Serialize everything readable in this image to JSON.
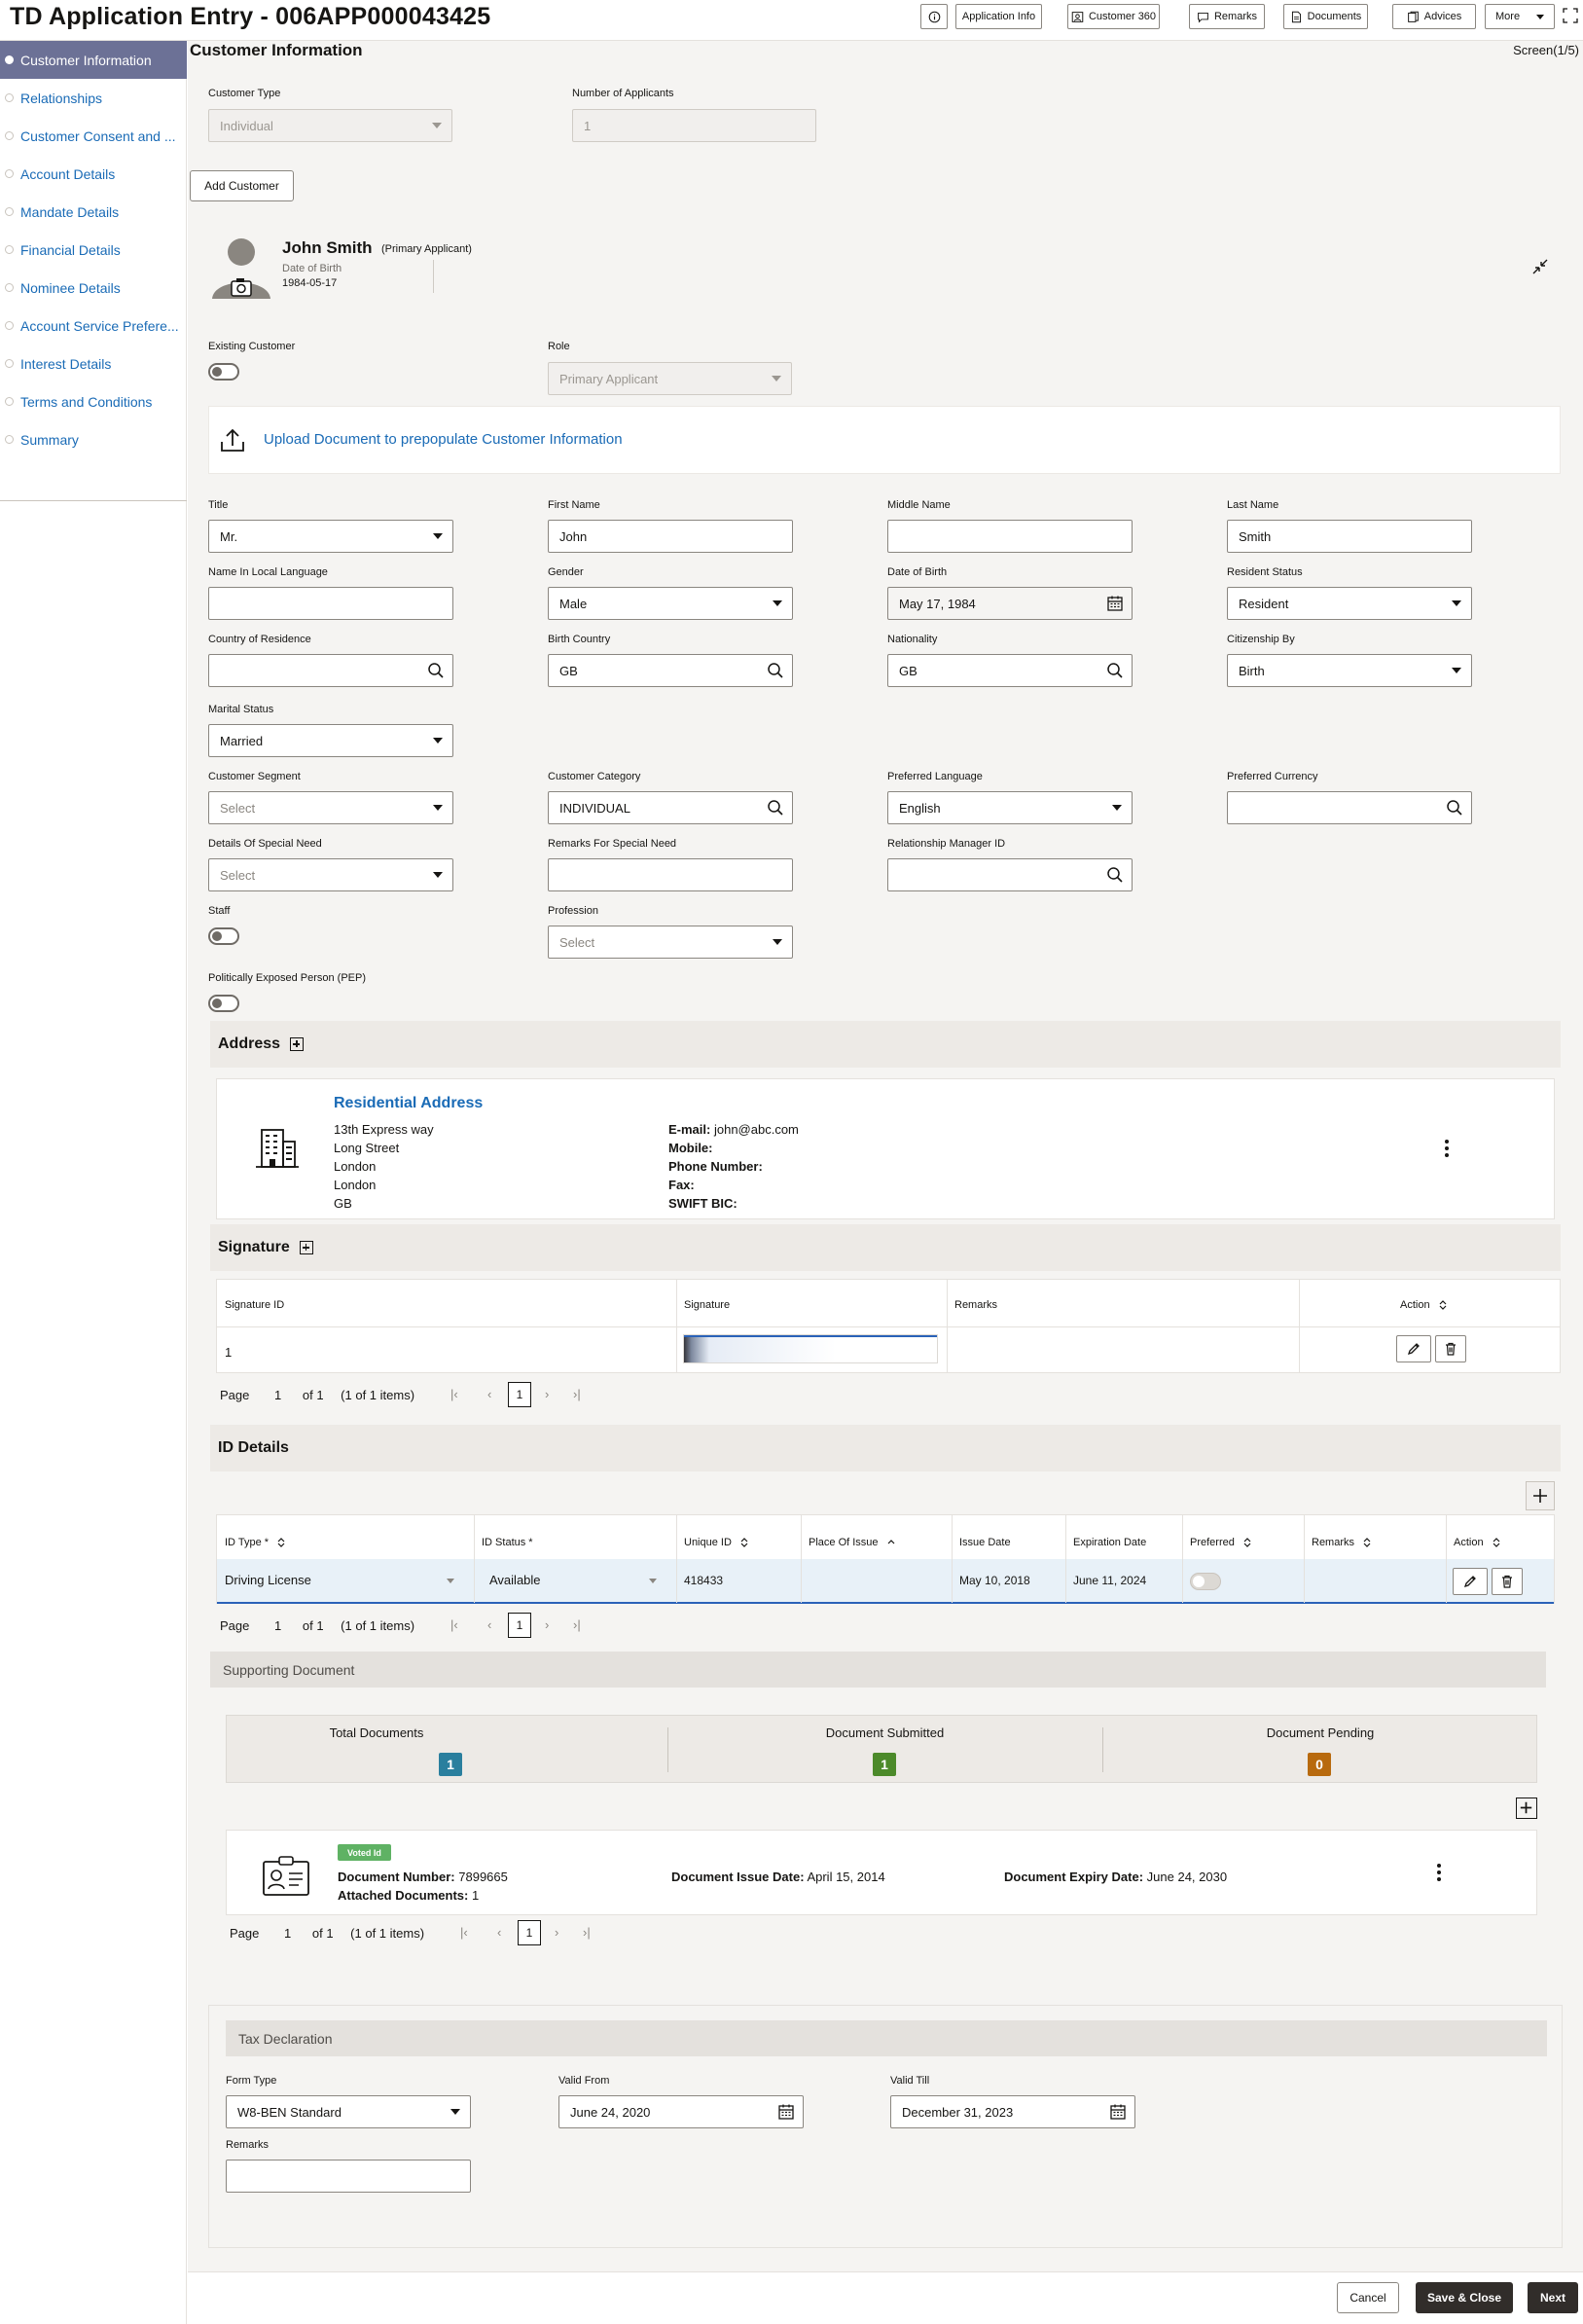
{
  "app": {
    "title": "TD Application Entry - 006APP000043425"
  },
  "toolbar": {
    "info_icon": "info-icon",
    "buttons": [
      {
        "label": "Application Info"
      },
      {
        "label": "Customer 360"
      },
      {
        "label": "Remarks"
      },
      {
        "label": "Documents"
      },
      {
        "label": "Advices"
      },
      {
        "label": "More"
      }
    ]
  },
  "sidebar": {
    "items": [
      {
        "label": "Customer Information",
        "active": true
      },
      {
        "label": "Relationships"
      },
      {
        "label": "Customer Consent and ..."
      },
      {
        "label": "Account Details"
      },
      {
        "label": "Mandate Details"
      },
      {
        "label": "Financial Details"
      },
      {
        "label": "Nominee Details"
      },
      {
        "label": "Account Service Prefere..."
      },
      {
        "label": "Interest Details"
      },
      {
        "label": "Terms and Conditions"
      },
      {
        "label": "Summary"
      }
    ]
  },
  "page": {
    "title": "Customer Information",
    "screen": "Screen(1/5)"
  },
  "customer_top": {
    "customer_type_label": "Customer Type",
    "customer_type_value": "Individual",
    "num_applicants_label": "Number of Applicants",
    "num_applicants_value": "1",
    "add_customer": "Add Customer"
  },
  "applicant": {
    "name": "John Smith",
    "tag": "(Primary Applicant)",
    "dob_label": "Date of Birth",
    "dob_value": "1984-05-17",
    "existing_customer_label": "Existing Customer",
    "role_label": "Role",
    "role_value": "Primary Applicant",
    "upload_label": "Upload Document to prepopulate Customer Information"
  },
  "form": {
    "title": {
      "label": "Title",
      "value": "Mr."
    },
    "first_name": {
      "label": "First Name",
      "value": "John"
    },
    "middle_name": {
      "label": "Middle Name",
      "value": ""
    },
    "last_name": {
      "label": "Last Name",
      "value": "Smith"
    },
    "local_name": {
      "label": "Name In Local Language",
      "value": ""
    },
    "gender": {
      "label": "Gender",
      "value": "Male"
    },
    "dob": {
      "label": "Date of Birth",
      "value": "May 17, 1984"
    },
    "resident_status": {
      "label": "Resident Status",
      "value": "Resident"
    },
    "country_residence": {
      "label": "Country of Residence",
      "value": ""
    },
    "birth_country": {
      "label": "Birth Country",
      "value": "GB"
    },
    "nationality": {
      "label": "Nationality",
      "value": "GB"
    },
    "citizenship_by": {
      "label": "Citizenship By",
      "value": "Birth"
    },
    "marital_status": {
      "label": "Marital Status",
      "value": "Married"
    },
    "customer_segment": {
      "label": "Customer Segment",
      "value": "Select"
    },
    "customer_category": {
      "label": "Customer Category",
      "value": "INDIVIDUAL"
    },
    "preferred_language": {
      "label": "Preferred Language",
      "value": "English"
    },
    "preferred_currency": {
      "label": "Preferred Currency",
      "value": ""
    },
    "special_need": {
      "label": "Details Of Special Need",
      "value": "Select"
    },
    "special_need_remarks": {
      "label": "Remarks For Special Need",
      "value": ""
    },
    "rm_id": {
      "label": "Relationship Manager ID",
      "value": ""
    },
    "staff": {
      "label": "Staff"
    },
    "profession": {
      "label": "Profession",
      "value": "Select"
    },
    "pep": {
      "label": "Politically Exposed Person (PEP)"
    }
  },
  "address": {
    "section_title": "Address",
    "card_title": "Residential Address",
    "lines": [
      "13th Express way",
      "Long Street",
      "London",
      "London",
      "GB"
    ],
    "email_label": "E-mail:",
    "email_value": "john@abc.com",
    "mobile_label": "Mobile:",
    "phone_label": "Phone Number:",
    "fax_label": "Fax:",
    "swift_label": "SWIFT BIC:"
  },
  "signature": {
    "section_title": "Signature",
    "columns": [
      "Signature ID",
      "Signature",
      "Remarks",
      "Action"
    ],
    "rows": [
      {
        "id": "1",
        "remarks": ""
      }
    ],
    "pager": {
      "page_label": "Page",
      "page": "1",
      "of": "of 1",
      "items": "(1 of 1 items)",
      "current": "1"
    }
  },
  "id_details": {
    "section_title": "ID Details",
    "columns": [
      "ID Type *",
      "ID Status *",
      "Unique ID",
      "Place Of Issue",
      "Issue Date",
      "Expiration Date",
      "Preferred",
      "Remarks",
      "Action"
    ],
    "rows": [
      {
        "id_type": "Driving License",
        "id_status": "Available",
        "unique_id": "418433",
        "place": "",
        "issue_date": "May 10, 2018",
        "expiry_date": "June 11, 2024",
        "remarks": ""
      }
    ],
    "pager": {
      "page_label": "Page",
      "page": "1",
      "of": "of 1",
      "items": "(1 of 1 items)",
      "current": "1"
    }
  },
  "supporting_docs": {
    "section_title": "Supporting Document",
    "total_label": "Total Documents",
    "total": "1",
    "submitted_label": "Document Submitted",
    "submitted": "1",
    "pending_label": "Document Pending",
    "pending": "0",
    "colors": {
      "total": "#2a7f9e",
      "submitted": "#4c8a2a",
      "pending": "#b86a0e",
      "tag": "#5fb264"
    },
    "doc": {
      "tag": "Voted Id",
      "number_label": "Document Number:",
      "number": "7899665",
      "attached_label": "Attached Documents:",
      "attached": "1",
      "issue_label": "Document Issue Date:",
      "issue": "April 15, 2014",
      "expiry_label": "Document Expiry Date:",
      "expiry": "June 24, 2030"
    },
    "pager": {
      "page_label": "Page",
      "page": "1",
      "of": "of 1",
      "items": "(1 of 1 items)",
      "current": "1"
    }
  },
  "tax": {
    "section_title": "Tax Declaration",
    "form_type_label": "Form Type",
    "form_type": "W8-BEN Standard",
    "valid_from_label": "Valid From",
    "valid_from": "June 24, 2020",
    "valid_till_label": "Valid Till",
    "valid_till": "December 31, 2023",
    "remarks_label": "Remarks",
    "remarks": ""
  },
  "footer": {
    "cancel": "Cancel",
    "save_close": "Save & Close",
    "next": "Next"
  }
}
